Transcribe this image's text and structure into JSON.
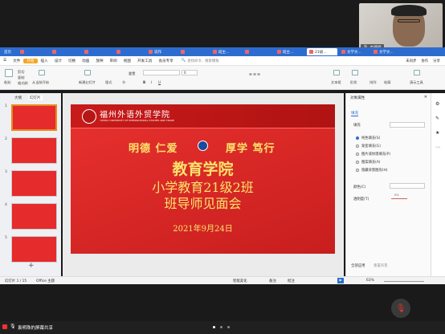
{
  "meeting": {
    "participant_name": "袁明珠",
    "share_label": "袁明珠的屏幕共享"
  },
  "tabs": [
    {
      "label": "首页",
      "active": false
    },
    {
      "label": "",
      "active": false
    },
    {
      "label": "",
      "active": false
    },
    {
      "label": "",
      "active": false
    },
    {
      "label": "",
      "active": false
    },
    {
      "label": "说作",
      "active": false
    },
    {
      "label": "",
      "active": false
    },
    {
      "label": "班主...",
      "active": false
    },
    {
      "label": "",
      "active": false
    },
    {
      "label": "班主...",
      "active": false
    },
    {
      "label": "21级...",
      "active": true
    },
    {
      "label": "文学文...",
      "active": false
    },
    {
      "label": "文学文...",
      "active": false
    }
  ],
  "menu": [
    "文件",
    "开始",
    "插入",
    "设计",
    "切换",
    "动画",
    "放映",
    "审阅",
    "视图",
    "开发工具",
    "会员专享"
  ],
  "menu_active": "开始",
  "search_placeholder": "查找命令、搜索模板",
  "top_right": {
    "unsync": "未同步",
    "collab": "协作",
    "share": "分享"
  },
  "ribbon": {
    "paste": "粘贴",
    "cut": "剪切",
    "copy": "复制",
    "format_painter": "格式刷",
    "from_start": "从当前开始",
    "new_slide": "新建幻灯片",
    "layout": "版式",
    "section": "节",
    "reset": "重置",
    "text_box": "文本框",
    "shape": "形状",
    "arrange": "排列",
    "outline": "轮廓",
    "present": "演示工具",
    "font_size": "0"
  },
  "left_panel": {
    "tab_outline": "大纲",
    "tab_slides": "幻灯片",
    "slide_numbers": [
      "1",
      "2",
      "3",
      "4",
      "5"
    ],
    "add": "+"
  },
  "slide": {
    "line1": "明德 仁爱",
    "line1b": "厚学 笃行",
    "title": "教育学院",
    "subtitle": "小学教育21级2班",
    "subtitle2": "班导师见面会",
    "date": "2021年9月24日",
    "school_name": "YIZHOU UNIVERSITY OF INTERNATIONAL STUDIES AND TRADE",
    "seal_text": "福州外语外贸学院"
  },
  "right_panel": {
    "header": "对象属性",
    "tab_fill": "填充",
    "section_fill": "填充",
    "options": [
      {
        "label": "纯色填充(S)",
        "checked": true
      },
      {
        "label": "渐变填充(G)",
        "checked": false
      },
      {
        "label": "图片或纹理填充(P)",
        "checked": false
      },
      {
        "label": "图案填充(A)",
        "checked": false
      },
      {
        "label": "隐藏背景图形(H)",
        "checked": false
      }
    ],
    "color_label": "颜色(C)",
    "transparency_label": "透明度(T)",
    "transparency_value": "0%",
    "apply_all": "全部应用",
    "reset_bg": "重置背景"
  },
  "status": {
    "slide_count": "幻灯片 1 / 15",
    "theme": "Office 主题",
    "smart_beautify": "智能美化",
    "notes": "备注",
    "comments": "批注",
    "zoom": "63%"
  },
  "colors": {
    "title_bar": "#2d6ccf",
    "slide_red": "#e8322f",
    "active_tab_orange": "#f6a623"
  }
}
